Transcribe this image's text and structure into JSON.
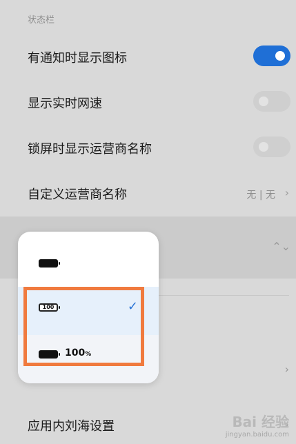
{
  "section": {
    "title": "状态栏"
  },
  "rows": [
    {
      "label": "有通知时显示图标",
      "toggle": true
    },
    {
      "label": "显示实时网速",
      "toggle": false
    },
    {
      "label": "锁屏时显示运营商名称",
      "toggle": false
    },
    {
      "label": "自定义运营商名称",
      "value": "无 | 无"
    },
    {
      "label": "应用内刘海设置"
    }
  ],
  "popup": {
    "options": [
      {
        "name": "solid-battery"
      },
      {
        "name": "battery-with-number",
        "badge": "100",
        "selected": true
      },
      {
        "name": "battery-with-percent",
        "text": "100",
        "unit": "%"
      }
    ]
  },
  "watermark": {
    "brand": "Bai 经验",
    "url": "jingyan.baidu.com"
  },
  "colors": {
    "accent": "#1f6fd6",
    "highlight": "#f07a3e",
    "check": "#2a74d6"
  }
}
